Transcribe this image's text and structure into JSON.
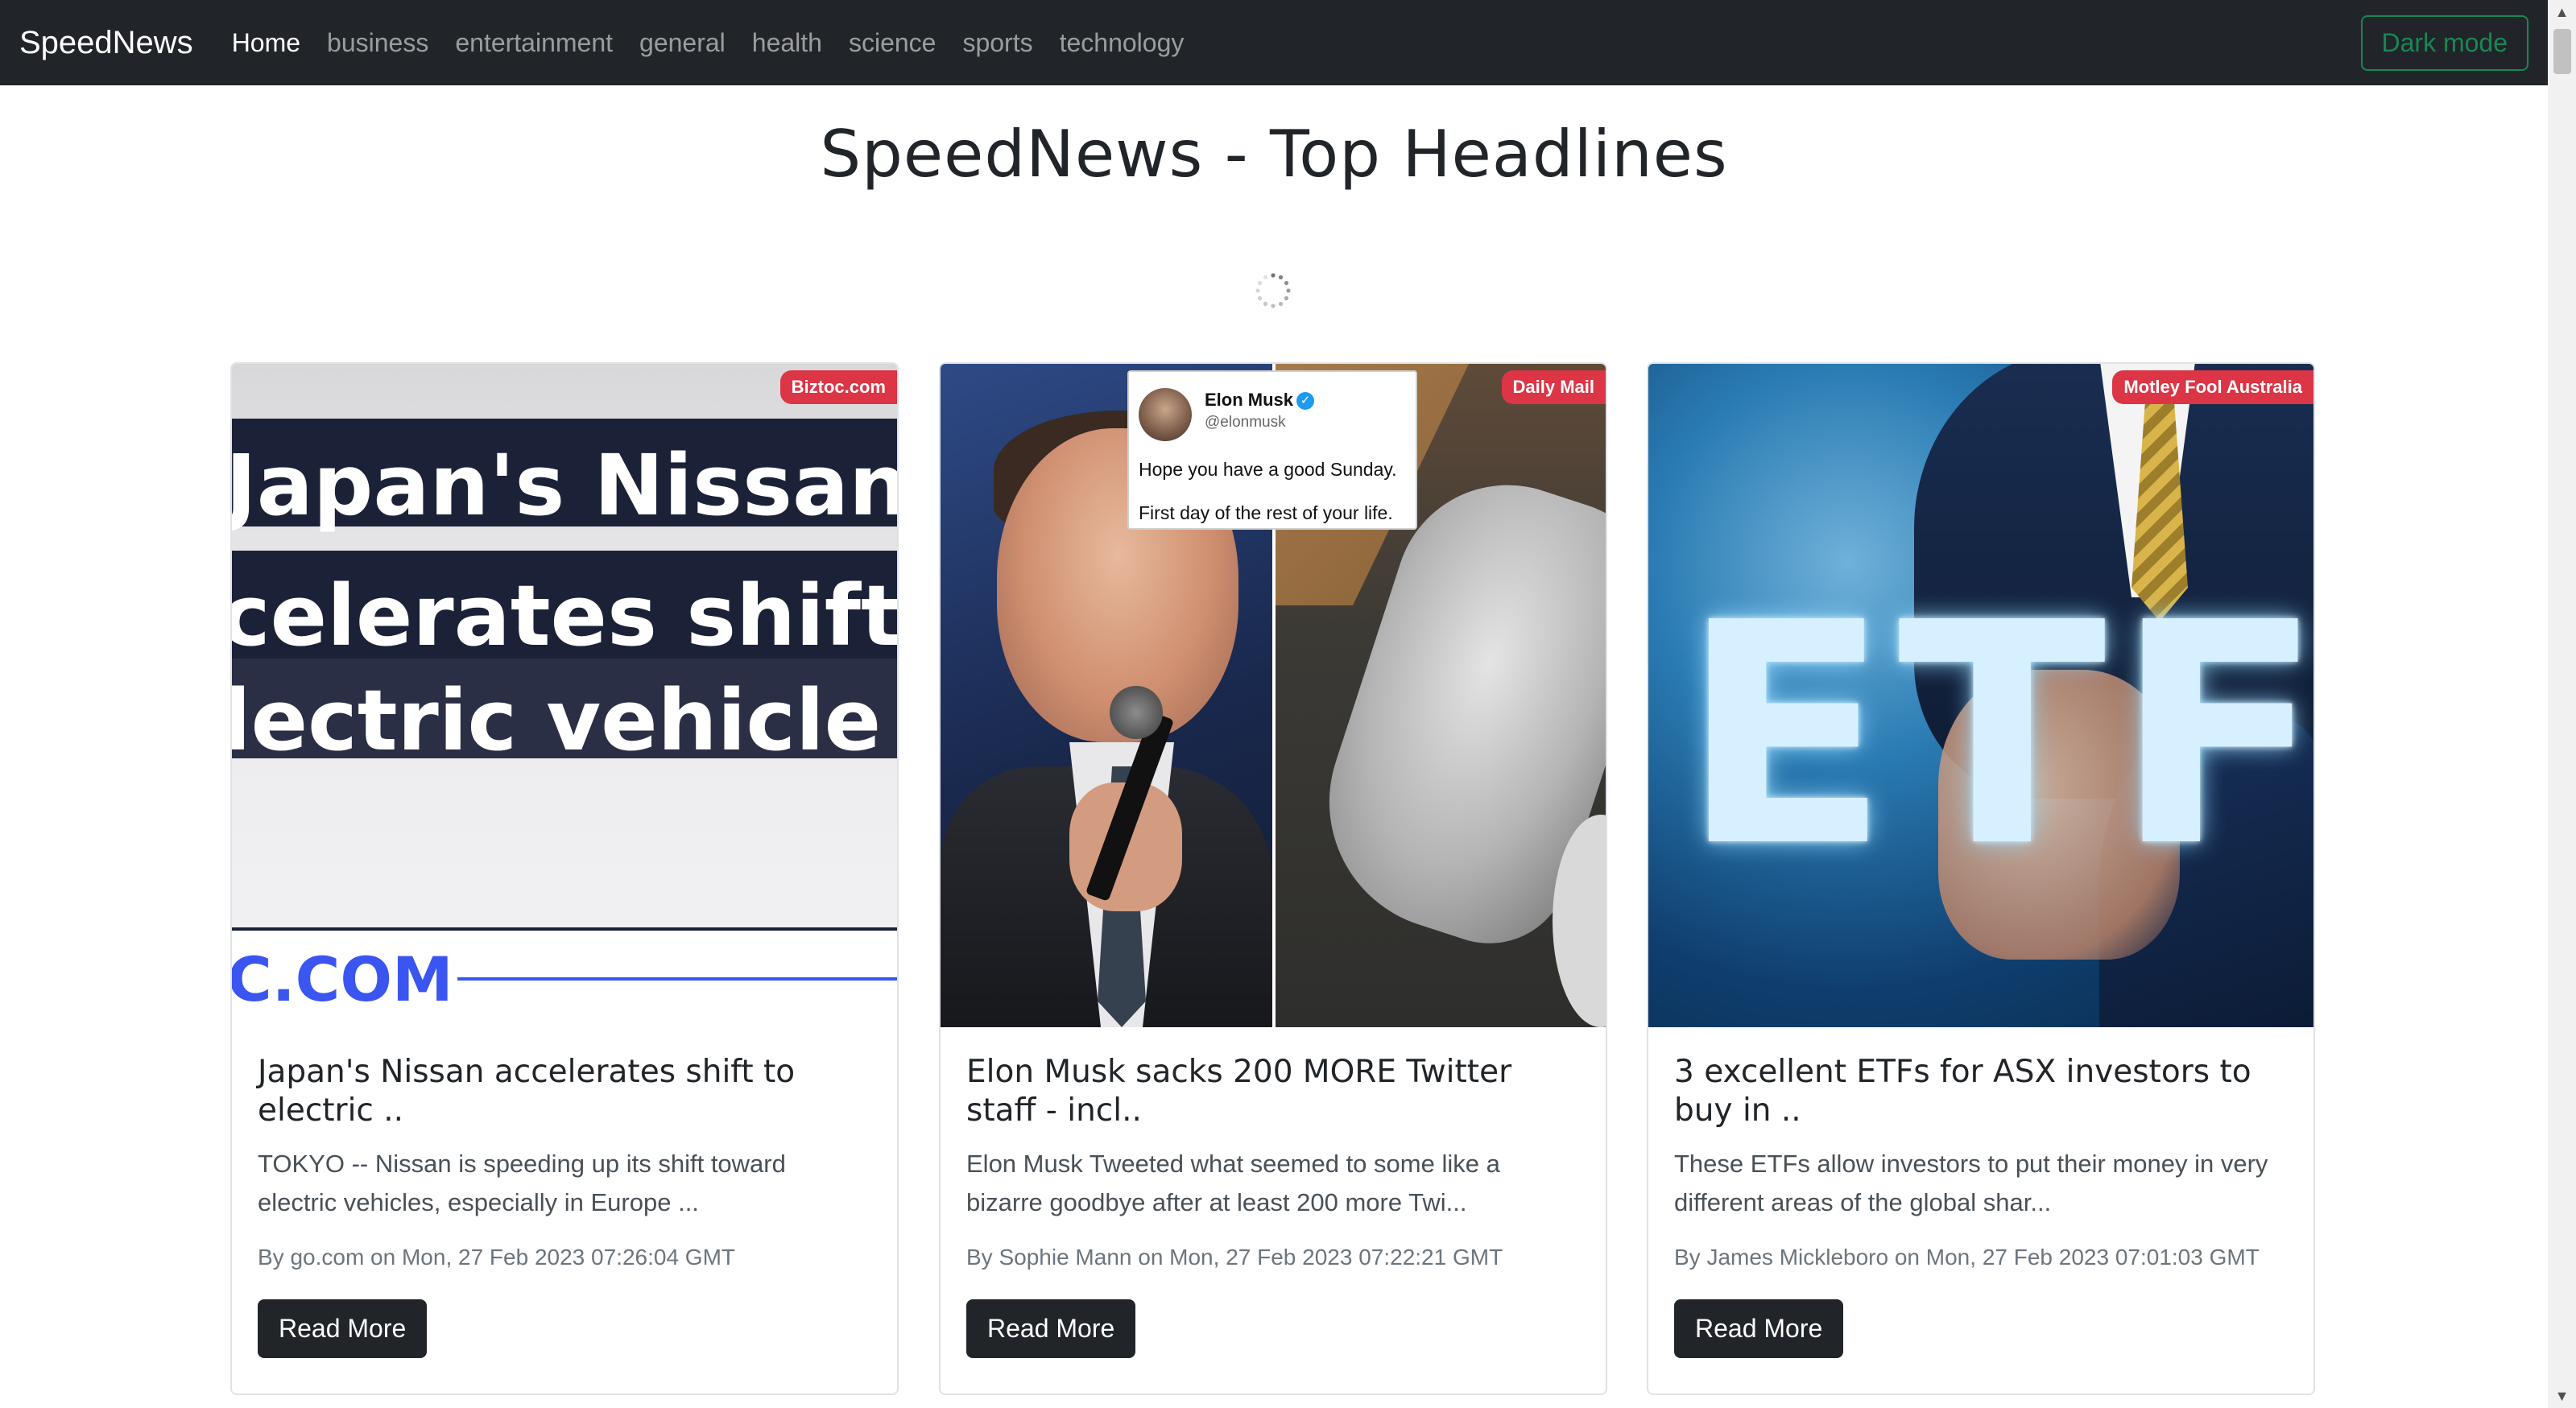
{
  "navbar": {
    "brand": "SpeedNews",
    "links": [
      "Home",
      "business",
      "entertainment",
      "general",
      "health",
      "science",
      "sports",
      "technology"
    ],
    "active_link": "Home",
    "dark_mode_label": "Dark mode"
  },
  "page_title": "SpeedNews - Top Headlines",
  "colors": {
    "navbar_bg": "#212529",
    "badge_bg": "#dc3545",
    "dark_toggle": "#198754",
    "button_bg": "#212529"
  },
  "cards": [
    {
      "source": "Biztoc.com",
      "image_text": [
        "Japan's Nissan",
        "celerates shift",
        "lectric vehicle",
        "C.COM"
      ],
      "title": "Japan's Nissan accelerates shift to electric ..",
      "description": "TOKYO -- Nissan is speeding up its shift toward electric vehicles, especially in Europe ...",
      "meta": "By go.com on Mon, 27 Feb 2023 07:26:04 GMT",
      "button_label": "Read More"
    },
    {
      "source": "Daily Mail",
      "tweet": {
        "name": "Elon Musk",
        "handle": "@elonmusk",
        "line1": "Hope you have a good Sunday.",
        "line2": "First day of the rest of your life."
      },
      "title": "Elon Musk sacks 200 MORE Twitter staff - incl..",
      "description": "Elon Musk Tweeted what seemed to some like a bizarre goodbye after at least 200 more Twi...",
      "meta": "By Sophie Mann on Mon, 27 Feb 2023 07:22:21 GMT",
      "button_label": "Read More"
    },
    {
      "source": "Motley Fool Australia",
      "image_text": "ETF",
      "title": "3 excellent ETFs for ASX investors to buy in ..",
      "description": "These ETFs allow investors to put their money in very different areas of the global shar...",
      "meta": "By James Mickleboro on Mon, 27 Feb 2023 07:01:03 GMT",
      "button_label": "Read More"
    }
  ],
  "icons": {
    "spinner": "loading-spinner-icon",
    "verified": "verified-badge-icon",
    "scroll_up": "▲",
    "scroll_down": "▼"
  }
}
